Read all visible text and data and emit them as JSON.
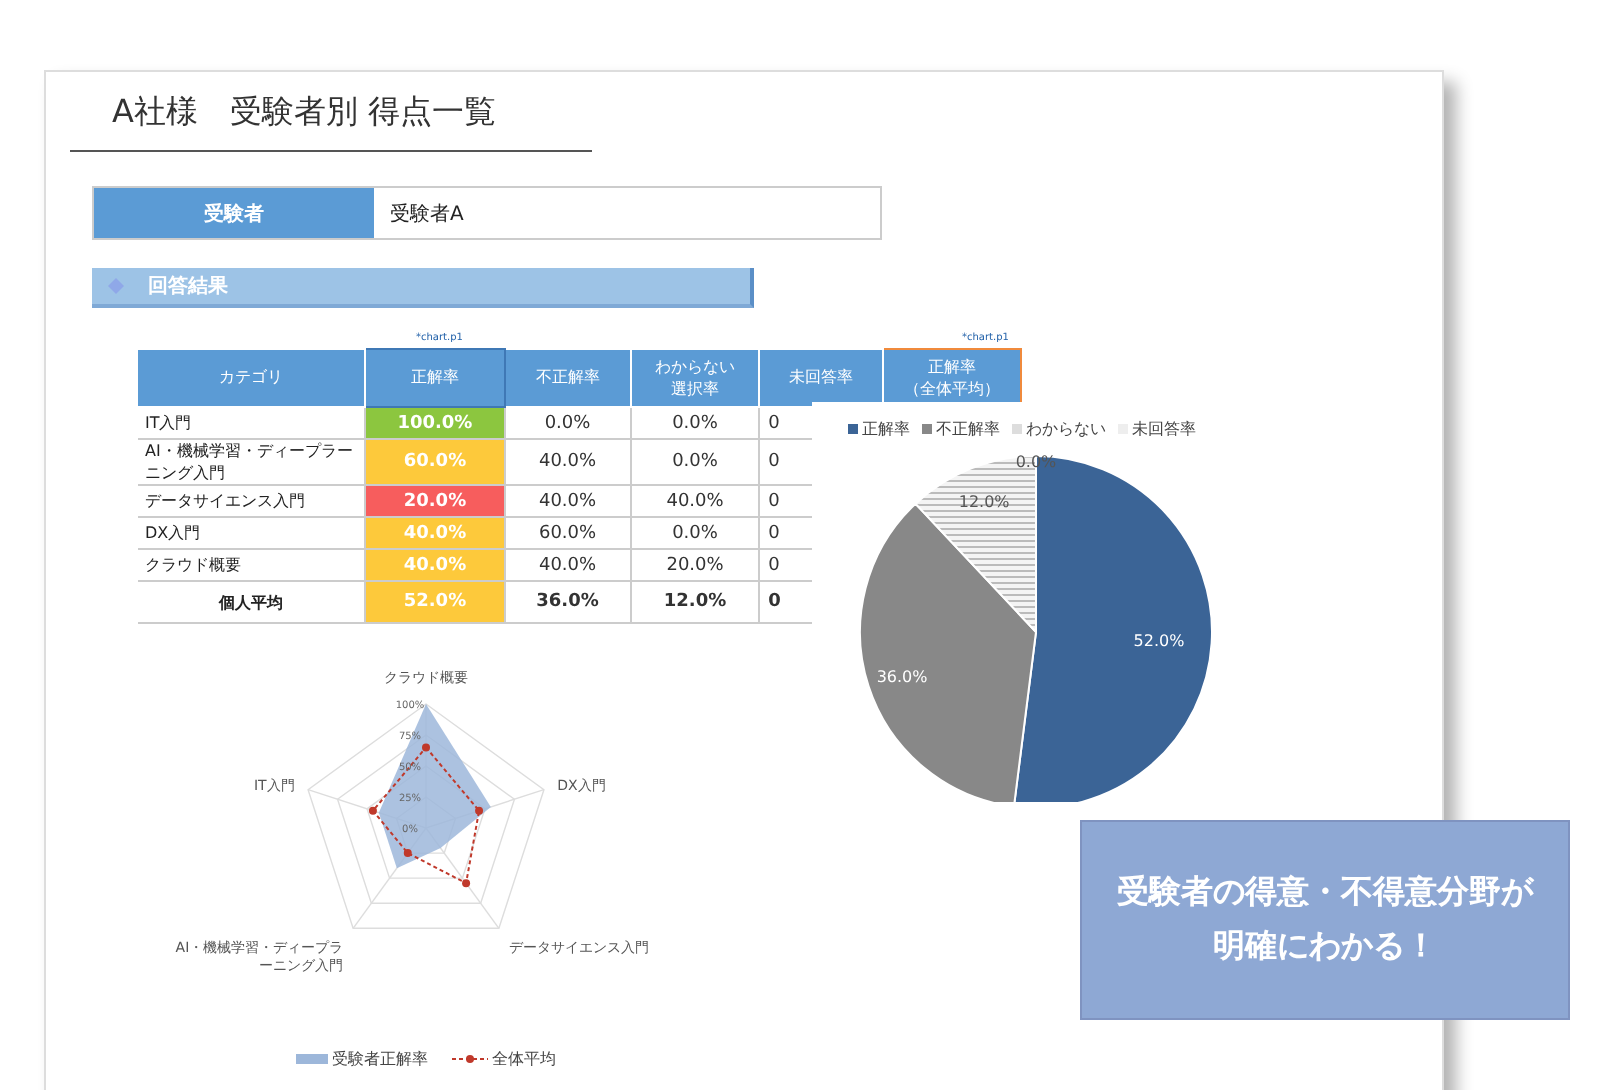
{
  "title": "A社様　受験者別 得点一覧",
  "examinee": {
    "label": "受験者",
    "value": "受験者A"
  },
  "section": {
    "label": "回答結果"
  },
  "chart_notes": [
    "*chart.p1",
    "*chart.p1"
  ],
  "table": {
    "columns": [
      {
        "lines": [
          "カテゴリ"
        ]
      },
      {
        "lines": [
          "正解率"
        ]
      },
      {
        "lines": [
          "不正解率"
        ]
      },
      {
        "lines": [
          "わからない",
          "選択率"
        ]
      },
      {
        "lines": [
          "未回答率"
        ]
      },
      {
        "lines": [
          "正解率",
          "（全体平均）"
        ]
      }
    ],
    "rows": [
      {
        "cells": [
          "IT入門",
          "100.0%",
          "0.0%",
          "0.0%",
          "0"
        ],
        "color": "#8cc63f"
      },
      {
        "cells": [
          "AI・機械学習・ディープラーニング入門",
          "60.0%",
          "40.0%",
          "0.0%",
          "0"
        ],
        "color": "#fdc93b"
      },
      {
        "cells": [
          "データサイエンス入門",
          "20.0%",
          "40.0%",
          "40.0%",
          "0"
        ],
        "color": "#f75d5d"
      },
      {
        "cells": [
          "DX入門",
          "40.0%",
          "60.0%",
          "0.0%",
          "0"
        ],
        "color": "#fdc93b"
      },
      {
        "cells": [
          "クラウド概要",
          "40.0%",
          "40.0%",
          "20.0%",
          "0"
        ],
        "color": "#fdc93b"
      },
      {
        "cells": [
          "個人平均",
          "52.0%",
          "36.0%",
          "12.0%",
          "0"
        ],
        "color": "#fdc93b"
      }
    ]
  },
  "pie": {
    "chart_data": {
      "type": "pie",
      "categories": [
        "正解率",
        "不正解率",
        "わからない",
        "未回答率"
      ],
      "series": [
        {
          "values": [
            52.0,
            36.0,
            12.0,
            0.0
          ]
        }
      ],
      "data_labels": "value_labels",
      "legend": "top",
      "value_labels": [
        "52.0%",
        "36.0%",
        "12.0%",
        "0.0%"
      ]
    }
  },
  "radar": {
    "axis_labels": [
      "クラウド概要",
      "IT入門",
      "DX入門",
      "AI・機械学習・ディープラーニング入門",
      "データサイエンス入門"
    ],
    "tick_labels": [
      "100%",
      "75%",
      "50%",
      "25%",
      "0%"
    ],
    "legend": [
      "受験者正解率",
      "全体平均"
    ]
  },
  "callout": {
    "lines": [
      "受験者の得意・不得意分野が",
      "明確にわかる！"
    ]
  }
}
